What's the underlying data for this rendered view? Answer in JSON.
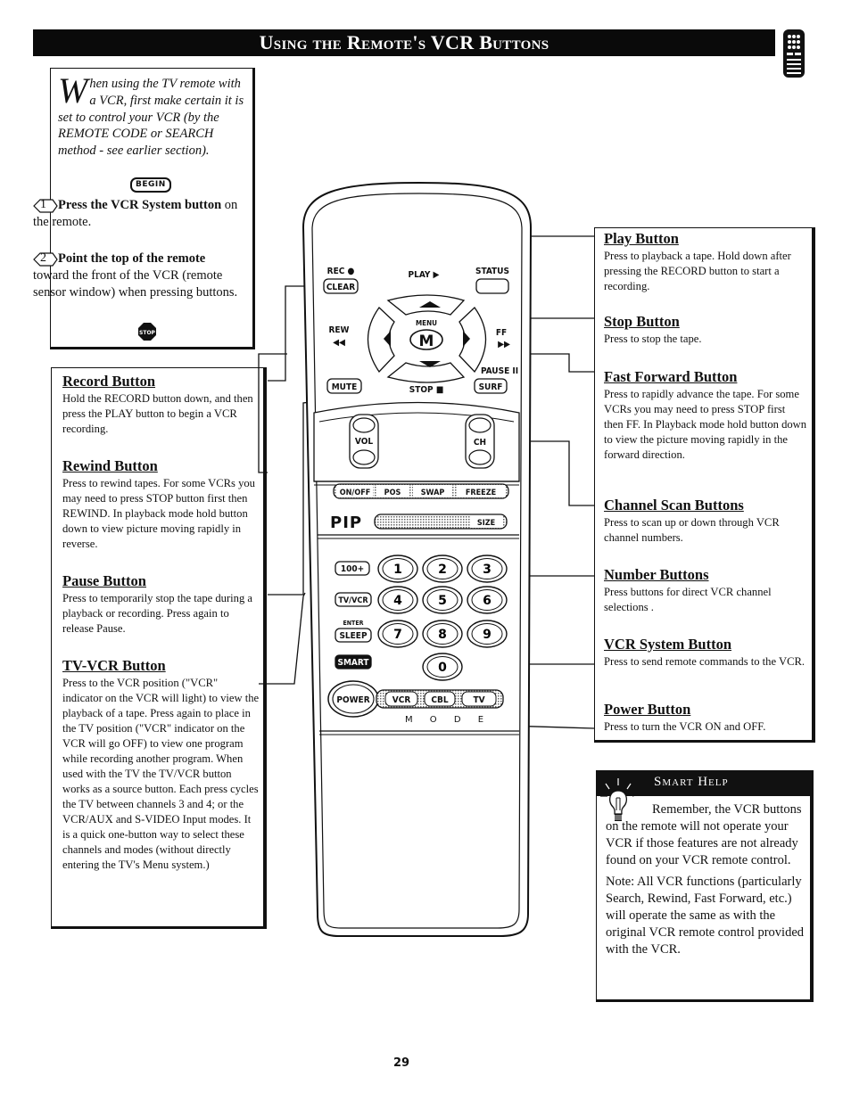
{
  "header": {
    "title": "Using the Remote's VCR Buttons",
    "icon": "remote-control-icon"
  },
  "intro": {
    "dropcap": "W",
    "text": "hen using the TV remote with a VCR, first make certain it is set to control your VCR (by the REMOTE CODE or SEARCH method - see earlier section).",
    "begin_label": "BEGIN",
    "steps": [
      {
        "number": "1",
        "bold": "Press the VCR System button",
        "rest": " on the remote."
      },
      {
        "number": "2",
        "bold": "Point the top of the remote",
        "rest": " toward the front of the VCR (remote sensor window) when pressing buttons."
      }
    ],
    "stop_label": "STOP"
  },
  "left_sections": [
    {
      "title": "Record Button",
      "text": "Hold the RECORD button down, and then press the PLAY button to begin a VCR recording."
    },
    {
      "title": "Rewind Button",
      "text": "Press to rewind tapes. For some VCRs you may need to press STOP button first then REWIND. In playback mode hold button down to view picture moving rapidly in reverse."
    },
    {
      "title": "Pause Button",
      "text": "Press to temporarily stop the tape during a playback or recording. Press again to release Pause."
    },
    {
      "title": "TV-VCR Button",
      "text": "Press to the VCR position (\"VCR\" indicator on the VCR will light) to view the playback of a tape. Press again to place in the TV position (\"VCR\" indicator on the VCR will go OFF) to view one program while recording another program. When used with the TV the TV/VCR button works as a source button. Each press cycles the TV between channels 3 and 4; or the VCR/AUX and S-VIDEO Input modes. It is a quick one-button way to select these channels and modes (without directly entering the TV's Menu system.)"
    }
  ],
  "right_sections": [
    {
      "title": "Play Button",
      "text": "Press to playback a tape. Hold down after pressing the RECORD button to start a recording."
    },
    {
      "title": "Stop Button",
      "text": "Press to stop the tape."
    },
    {
      "title": "Fast Forward Button",
      "text": "Press to rapidly advance the tape. For some VCRs you may need to press STOP first then FF. In Playback mode hold button down to view the picture moving rapidly in the forward direction."
    },
    {
      "title": "Channel Scan Buttons",
      "text": "Press to scan up or down through VCR channel numbers."
    },
    {
      "title": "Number Buttons",
      "text": "Press buttons for direct VCR channel selections ."
    },
    {
      "title": "VCR System Button",
      "text": "Press to send remote commands to the VCR."
    },
    {
      "title": "Power Button",
      "text": "Press to turn the VCR ON and OFF."
    }
  ],
  "smart_help": {
    "title": "Smart Help",
    "paragraphs": [
      "Remember, the VCR buttons on the remote will not operate your VCR if those features are not already found on your VCR remote control.",
      "Note: All VCR functions (particularly Search, Rewind, Fast Forward, etc.) will operate the same as with the original VCR remote control provided with the VCR."
    ]
  },
  "remote": {
    "rec": "REC ●",
    "clear": "CLEAR",
    "play": "PLAY ▶",
    "status": "STATUS",
    "rew": "REW",
    "rew_sym": "◀◀",
    "menu": "MENU",
    "m": "M",
    "ff": "FF",
    "ff_sym": "▶▶",
    "pause": "PAUSE II",
    "mute": "MUTE",
    "stop": "STOP ■",
    "surf": "SURF",
    "vol": "VOL",
    "ch": "CH",
    "pip_buttons": [
      "ON/OFF",
      "POS",
      "SWAP",
      "FREEZE"
    ],
    "pip_label": "PIP",
    "size": "SIZE",
    "hundred": "100+",
    "tvvcr": "TV/VCR",
    "enter": "ENTER",
    "sleep": "SLEEP",
    "smart": "SMART",
    "numbers": [
      "1",
      "2",
      "3",
      "4",
      "5",
      "6",
      "7",
      "8",
      "9",
      "0"
    ],
    "power": "POWER",
    "modes": [
      "VCR",
      "CBL",
      "TV"
    ],
    "mode_label": "M O D E"
  },
  "page_number": "29"
}
